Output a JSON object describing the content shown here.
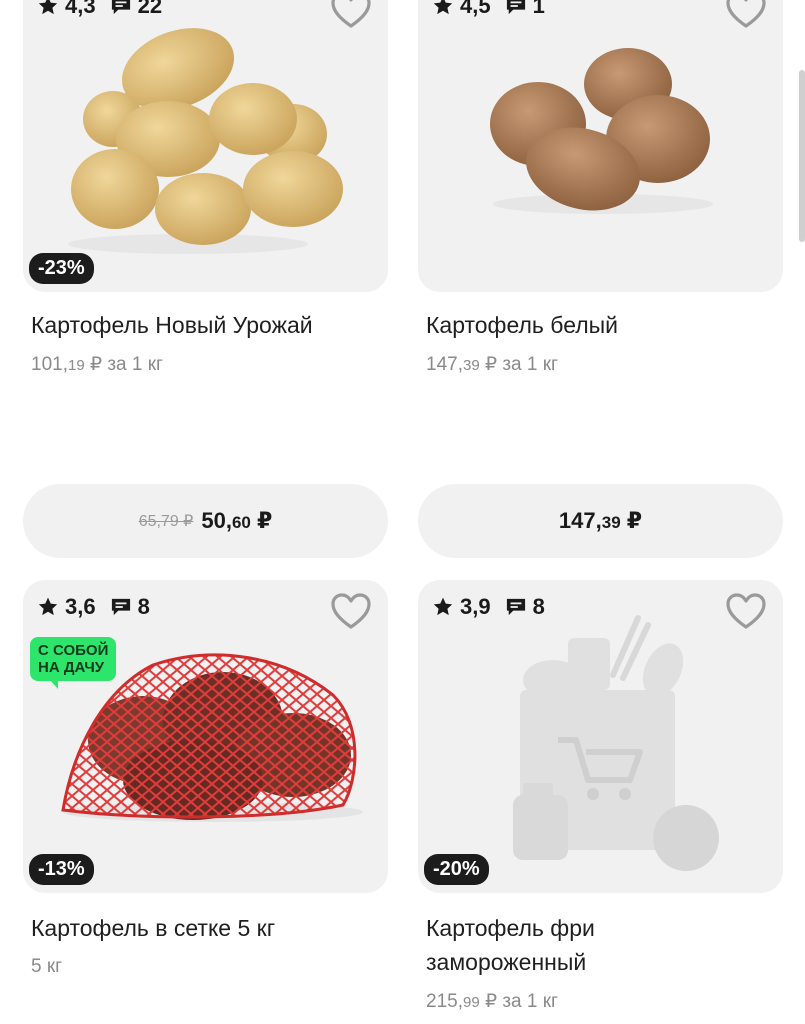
{
  "products": [
    {
      "rating": "4,3",
      "reviews": "22",
      "discount": "-23%",
      "name": "Картофель Новый Урожай",
      "unit_main": "101,",
      "unit_kop": "19",
      "unit_rest": " ₽ за 1 кг",
      "old_price": "65,79 ₽",
      "price_main": "50,",
      "price_kop": "60",
      "price_cur": " ₽"
    },
    {
      "rating": "4,5",
      "reviews": "1",
      "name": "Картофель белый",
      "unit_main": "147,",
      "unit_kop": "39",
      "unit_rest": " ₽ за 1 кг",
      "price_main": "147,",
      "price_kop": "39",
      "price_cur": " ₽"
    },
    {
      "rating": "3,6",
      "reviews": "8",
      "discount": "-13%",
      "tag_line1": "С СОБОЙ",
      "tag_line2": "НА ДАЧУ",
      "name": "Картофель в сетке 5 кг",
      "unit_text": "5 кг"
    },
    {
      "rating": "3,9",
      "reviews": "8",
      "discount": "-20%",
      "name_line1": "Картофель фри",
      "name_line2": "замороженный",
      "unit_main": "215,",
      "unit_kop": "99",
      "unit_rest": " ₽ за 1 кг"
    }
  ],
  "icons": [
    "star-icon",
    "comment-icon",
    "heart-icon"
  ],
  "colors": {
    "card_bg": "#f1f1f1",
    "badge_bg": "#1c1c1c",
    "tag_bg": "#2ee56b"
  }
}
